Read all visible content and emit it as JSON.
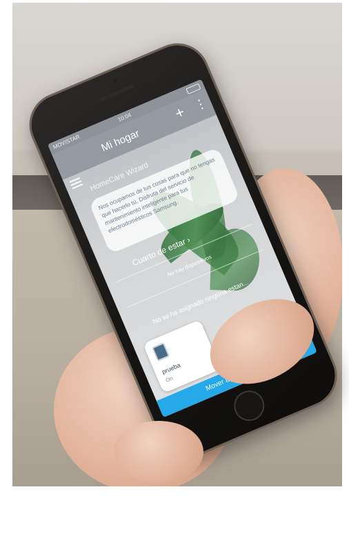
{
  "status_bar": {
    "carrier": "MOVISTAR",
    "time": "10:04"
  },
  "app_bar": {
    "title": "Mi hogar",
    "add_glyph": "+",
    "more_glyph": "⋮"
  },
  "wizard": {
    "title": "HomeCare Wizard",
    "message": "Nos ocupamos de tus cosas para que no tengas que hacerlo tú. Disfruta del servicio de mantenimiento inteligente para tus electrodomésticos Samsung."
  },
  "room": {
    "title": "Cuarto de estar ›",
    "empty_text": "No hay dispositivos"
  },
  "unassigned": {
    "title": "No se ha asignado ninguna estan..."
  },
  "device": {
    "name": "prueba",
    "state": "On"
  },
  "action": {
    "move_label": "Mover a otra estancia"
  },
  "icons": [
    "menu-icon",
    "add-icon",
    "more-icon",
    "device-icon",
    "home-button"
  ],
  "colors": {
    "accent": "#26a9e8",
    "app_bar": "#949aa0",
    "leaf": "#4e9153"
  }
}
